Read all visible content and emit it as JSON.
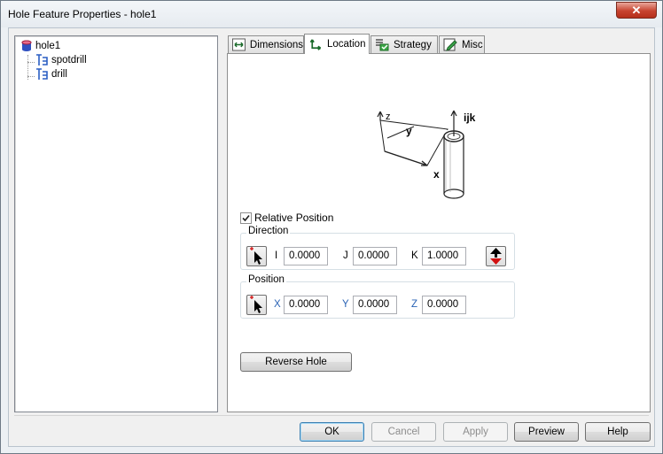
{
  "window": {
    "title": "Hole Feature Properties - hole1",
    "close_glyph": "✕"
  },
  "tree": {
    "root": {
      "label": "hole1",
      "icon": "cylinder-icon"
    },
    "children": [
      {
        "label": "spotdrill",
        "icon": "tool-icon"
      },
      {
        "label": "drill",
        "icon": "tool-icon"
      }
    ]
  },
  "tabs": [
    {
      "label": "Dimensions",
      "icon": "dimensions-icon",
      "active": false
    },
    {
      "label": "Location",
      "icon": "location-icon",
      "active": true
    },
    {
      "label": "Strategy",
      "icon": "strategy-icon",
      "active": false
    },
    {
      "label": "Misc",
      "icon": "misc-icon",
      "active": false
    }
  ],
  "diagram": {
    "labels": {
      "z": "z",
      "y": "y",
      "x": "x",
      "ijk": "ijk"
    }
  },
  "location": {
    "relative_position": {
      "label": "Relative Position",
      "checked": true
    },
    "direction": {
      "title": "Direction",
      "i_label": "I",
      "i_value": "0.0000",
      "j_label": "J",
      "j_value": "0.0000",
      "k_label": "K",
      "k_value": "1.0000"
    },
    "position": {
      "title": "Position",
      "x_label": "X",
      "x_value": "0.0000",
      "y_label": "Y",
      "y_value": "0.0000",
      "z_label": "Z",
      "z_value": "0.0000"
    },
    "reverse_hole_label": "Reverse Hole"
  },
  "buttons": {
    "ok": "OK",
    "cancel": "Cancel",
    "apply": "Apply",
    "preview": "Preview",
    "help": "Help"
  },
  "colors": {
    "accent_red": "#d21010",
    "label_blue": "#2a63b5",
    "tree_icon": "#2b5fc4"
  }
}
